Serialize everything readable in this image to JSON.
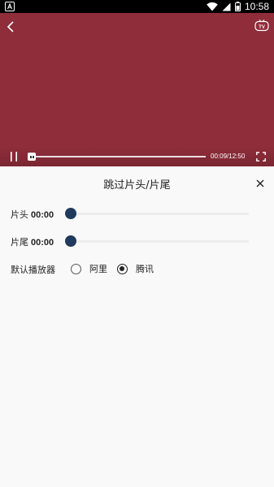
{
  "status_bar": {
    "time": "10:58",
    "icons": [
      "notification-a-icon",
      "wifi-icon",
      "signal-icon",
      "battery-icon"
    ]
  },
  "video": {
    "background_color": "#8f2d3a",
    "current_time": "00:09",
    "total_time": "12:50",
    "time_display": "00:09/12:50",
    "progress_fraction": 0.012,
    "icons": [
      "back-icon",
      "tv-cast-icon",
      "pause-icon",
      "fullscreen-icon"
    ]
  },
  "panel": {
    "title": "跳过片头/片尾",
    "close_icon": "close-icon",
    "intro": {
      "label": "片头",
      "time": "00:00",
      "value_fraction": 0
    },
    "outro": {
      "label": "片尾",
      "time": "00:00",
      "value_fraction": 0
    },
    "player": {
      "label": "默认播放器",
      "options": [
        {
          "label": "阿里",
          "checked": false
        },
        {
          "label": "腾讯",
          "checked": true
        }
      ]
    },
    "accent_color": "#1f3a5c"
  }
}
